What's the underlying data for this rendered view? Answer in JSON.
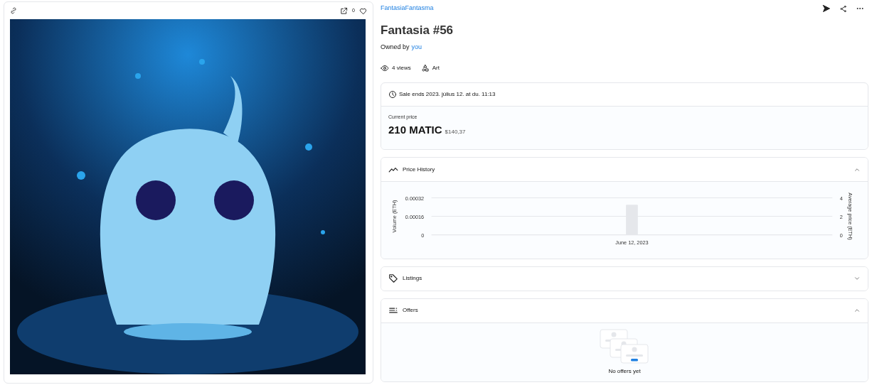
{
  "media": {
    "like_count": "0"
  },
  "collection": "FantasiaFantasma",
  "title": "Fantasia #56",
  "owner": {
    "prefix": "Owned by",
    "name": "you"
  },
  "stats": [
    {
      "kind": "views",
      "label": "4 views"
    },
    {
      "kind": "category",
      "label": "Art"
    }
  ],
  "sale": {
    "ends": "Sale ends 2023. július 12. at du. 11:13",
    "price_label": "Current price",
    "price": "210 MATIC",
    "fiat": "$140,37"
  },
  "panels": [
    {
      "kind": "chart",
      "title": "Price History",
      "expanded": true,
      "chart_data": {
        "type": "bar",
        "ylabel": "Volume (ETH)",
        "categories": [
          "June 12, 2023"
        ],
        "series": [
          {
            "color": "#e5e7eb",
            "values": [
              0.00026
            ]
          }
        ],
        "ylim": [
          0,
          0.00032
        ],
        "yticks": [
          {
            "value": 0,
            "label": "0"
          },
          {
            "value": 0.00016,
            "label": "0.00016"
          },
          {
            "value": 0.00032,
            "label": "0.00032"
          }
        ]
      },
      "right_axis": {
        "title": "Average price (ETH)",
        "labels": [
          "4",
          "2",
          "0"
        ]
      }
    },
    {
      "kind": "list",
      "title": "Listings",
      "expanded": false
    },
    {
      "kind": "empty",
      "title": "Offers",
      "expanded": true,
      "empty_text": "No offers yet"
    }
  ]
}
